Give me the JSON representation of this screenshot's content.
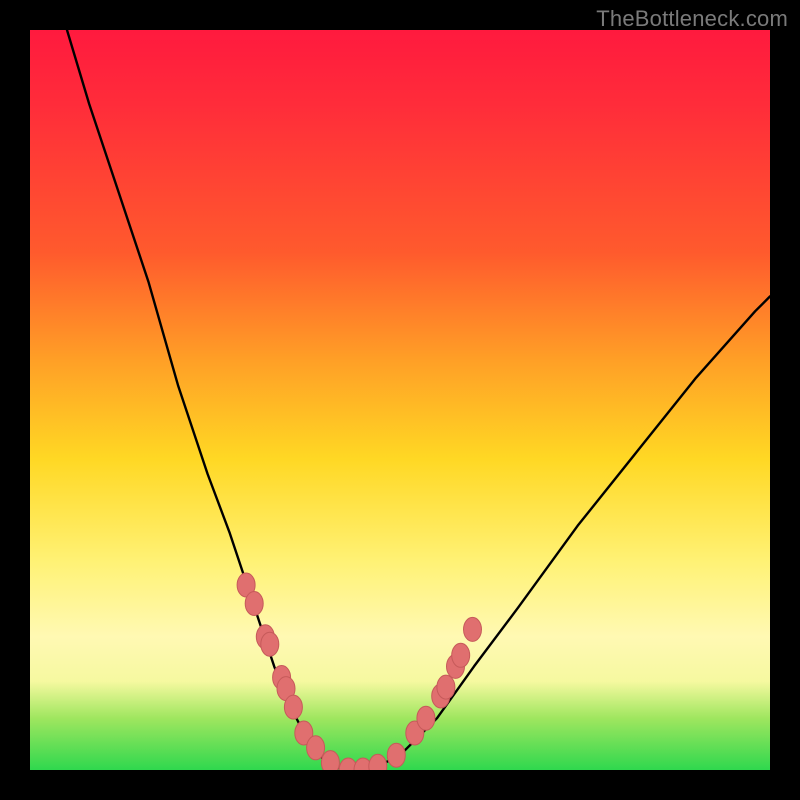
{
  "watermark": {
    "text": "TheBottleneck.com"
  },
  "colors": {
    "background": "#000000",
    "curve": "#000000",
    "marker_fill": "#e06f6f",
    "marker_stroke": "#c65a5a",
    "gradient_stops": [
      "#ff1a3e",
      "#ff2c3a",
      "#ff5a2d",
      "#ffa126",
      "#ffd824",
      "#fff276",
      "#fff9b3",
      "#f6f9a0",
      "#9fe65f",
      "#2fd84e"
    ]
  },
  "chart_data": {
    "type": "line",
    "title": "",
    "xlabel": "",
    "ylabel": "",
    "xlim": [
      0,
      100
    ],
    "ylim": [
      0,
      100
    ],
    "grid": false,
    "legend": false,
    "series": [
      {
        "name": "bottleneck-curve",
        "x": [
          5,
          8,
          12,
          16,
          20,
          24,
          27,
          29,
          31,
          33,
          35,
          37,
          39,
          41,
          43,
          45,
          47,
          50,
          55,
          60,
          66,
          74,
          82,
          90,
          98,
          100
        ],
        "y": [
          100,
          90,
          78,
          66,
          52,
          40,
          32,
          26,
          20,
          14,
          9,
          5,
          2,
          0.5,
          0,
          0,
          0.5,
          2,
          7,
          14,
          22,
          33,
          43,
          53,
          62,
          64
        ]
      }
    ],
    "markers": {
      "name": "highlighted-points",
      "x": [
        29.2,
        30.3,
        31.8,
        32.4,
        34.0,
        34.6,
        35.6,
        37.0,
        38.6,
        40.6,
        43.0,
        45.0,
        47.0,
        49.5,
        52.0,
        53.5,
        55.5,
        56.2,
        57.5,
        58.2,
        59.8
      ],
      "y": [
        25.0,
        22.5,
        18.0,
        17.0,
        12.5,
        11.0,
        8.5,
        5.0,
        3.0,
        1.0,
        0.0,
        0.0,
        0.5,
        2.0,
        5.0,
        7.0,
        10.0,
        11.2,
        14.0,
        15.5,
        19.0
      ]
    }
  }
}
